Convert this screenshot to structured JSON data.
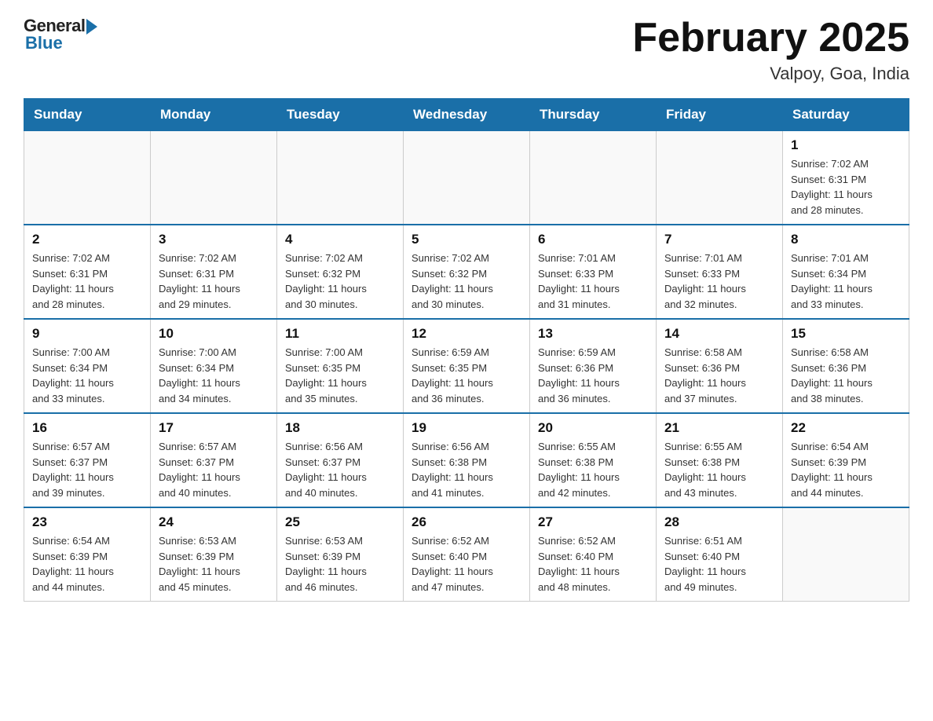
{
  "logo": {
    "general": "General",
    "blue": "Blue"
  },
  "title": {
    "month_year": "February 2025",
    "location": "Valpoy, Goa, India"
  },
  "days_of_week": [
    "Sunday",
    "Monday",
    "Tuesday",
    "Wednesday",
    "Thursday",
    "Friday",
    "Saturday"
  ],
  "weeks": [
    [
      {
        "num": "",
        "info": ""
      },
      {
        "num": "",
        "info": ""
      },
      {
        "num": "",
        "info": ""
      },
      {
        "num": "",
        "info": ""
      },
      {
        "num": "",
        "info": ""
      },
      {
        "num": "",
        "info": ""
      },
      {
        "num": "1",
        "info": "Sunrise: 7:02 AM\nSunset: 6:31 PM\nDaylight: 11 hours\nand 28 minutes."
      }
    ],
    [
      {
        "num": "2",
        "info": "Sunrise: 7:02 AM\nSunset: 6:31 PM\nDaylight: 11 hours\nand 28 minutes."
      },
      {
        "num": "3",
        "info": "Sunrise: 7:02 AM\nSunset: 6:31 PM\nDaylight: 11 hours\nand 29 minutes."
      },
      {
        "num": "4",
        "info": "Sunrise: 7:02 AM\nSunset: 6:32 PM\nDaylight: 11 hours\nand 30 minutes."
      },
      {
        "num": "5",
        "info": "Sunrise: 7:02 AM\nSunset: 6:32 PM\nDaylight: 11 hours\nand 30 minutes."
      },
      {
        "num": "6",
        "info": "Sunrise: 7:01 AM\nSunset: 6:33 PM\nDaylight: 11 hours\nand 31 minutes."
      },
      {
        "num": "7",
        "info": "Sunrise: 7:01 AM\nSunset: 6:33 PM\nDaylight: 11 hours\nand 32 minutes."
      },
      {
        "num": "8",
        "info": "Sunrise: 7:01 AM\nSunset: 6:34 PM\nDaylight: 11 hours\nand 33 minutes."
      }
    ],
    [
      {
        "num": "9",
        "info": "Sunrise: 7:00 AM\nSunset: 6:34 PM\nDaylight: 11 hours\nand 33 minutes."
      },
      {
        "num": "10",
        "info": "Sunrise: 7:00 AM\nSunset: 6:34 PM\nDaylight: 11 hours\nand 34 minutes."
      },
      {
        "num": "11",
        "info": "Sunrise: 7:00 AM\nSunset: 6:35 PM\nDaylight: 11 hours\nand 35 minutes."
      },
      {
        "num": "12",
        "info": "Sunrise: 6:59 AM\nSunset: 6:35 PM\nDaylight: 11 hours\nand 36 minutes."
      },
      {
        "num": "13",
        "info": "Sunrise: 6:59 AM\nSunset: 6:36 PM\nDaylight: 11 hours\nand 36 minutes."
      },
      {
        "num": "14",
        "info": "Sunrise: 6:58 AM\nSunset: 6:36 PM\nDaylight: 11 hours\nand 37 minutes."
      },
      {
        "num": "15",
        "info": "Sunrise: 6:58 AM\nSunset: 6:36 PM\nDaylight: 11 hours\nand 38 minutes."
      }
    ],
    [
      {
        "num": "16",
        "info": "Sunrise: 6:57 AM\nSunset: 6:37 PM\nDaylight: 11 hours\nand 39 minutes."
      },
      {
        "num": "17",
        "info": "Sunrise: 6:57 AM\nSunset: 6:37 PM\nDaylight: 11 hours\nand 40 minutes."
      },
      {
        "num": "18",
        "info": "Sunrise: 6:56 AM\nSunset: 6:37 PM\nDaylight: 11 hours\nand 40 minutes."
      },
      {
        "num": "19",
        "info": "Sunrise: 6:56 AM\nSunset: 6:38 PM\nDaylight: 11 hours\nand 41 minutes."
      },
      {
        "num": "20",
        "info": "Sunrise: 6:55 AM\nSunset: 6:38 PM\nDaylight: 11 hours\nand 42 minutes."
      },
      {
        "num": "21",
        "info": "Sunrise: 6:55 AM\nSunset: 6:38 PM\nDaylight: 11 hours\nand 43 minutes."
      },
      {
        "num": "22",
        "info": "Sunrise: 6:54 AM\nSunset: 6:39 PM\nDaylight: 11 hours\nand 44 minutes."
      }
    ],
    [
      {
        "num": "23",
        "info": "Sunrise: 6:54 AM\nSunset: 6:39 PM\nDaylight: 11 hours\nand 44 minutes."
      },
      {
        "num": "24",
        "info": "Sunrise: 6:53 AM\nSunset: 6:39 PM\nDaylight: 11 hours\nand 45 minutes."
      },
      {
        "num": "25",
        "info": "Sunrise: 6:53 AM\nSunset: 6:39 PM\nDaylight: 11 hours\nand 46 minutes."
      },
      {
        "num": "26",
        "info": "Sunrise: 6:52 AM\nSunset: 6:40 PM\nDaylight: 11 hours\nand 47 minutes."
      },
      {
        "num": "27",
        "info": "Sunrise: 6:52 AM\nSunset: 6:40 PM\nDaylight: 11 hours\nand 48 minutes."
      },
      {
        "num": "28",
        "info": "Sunrise: 6:51 AM\nSunset: 6:40 PM\nDaylight: 11 hours\nand 49 minutes."
      },
      {
        "num": "",
        "info": ""
      }
    ]
  ]
}
